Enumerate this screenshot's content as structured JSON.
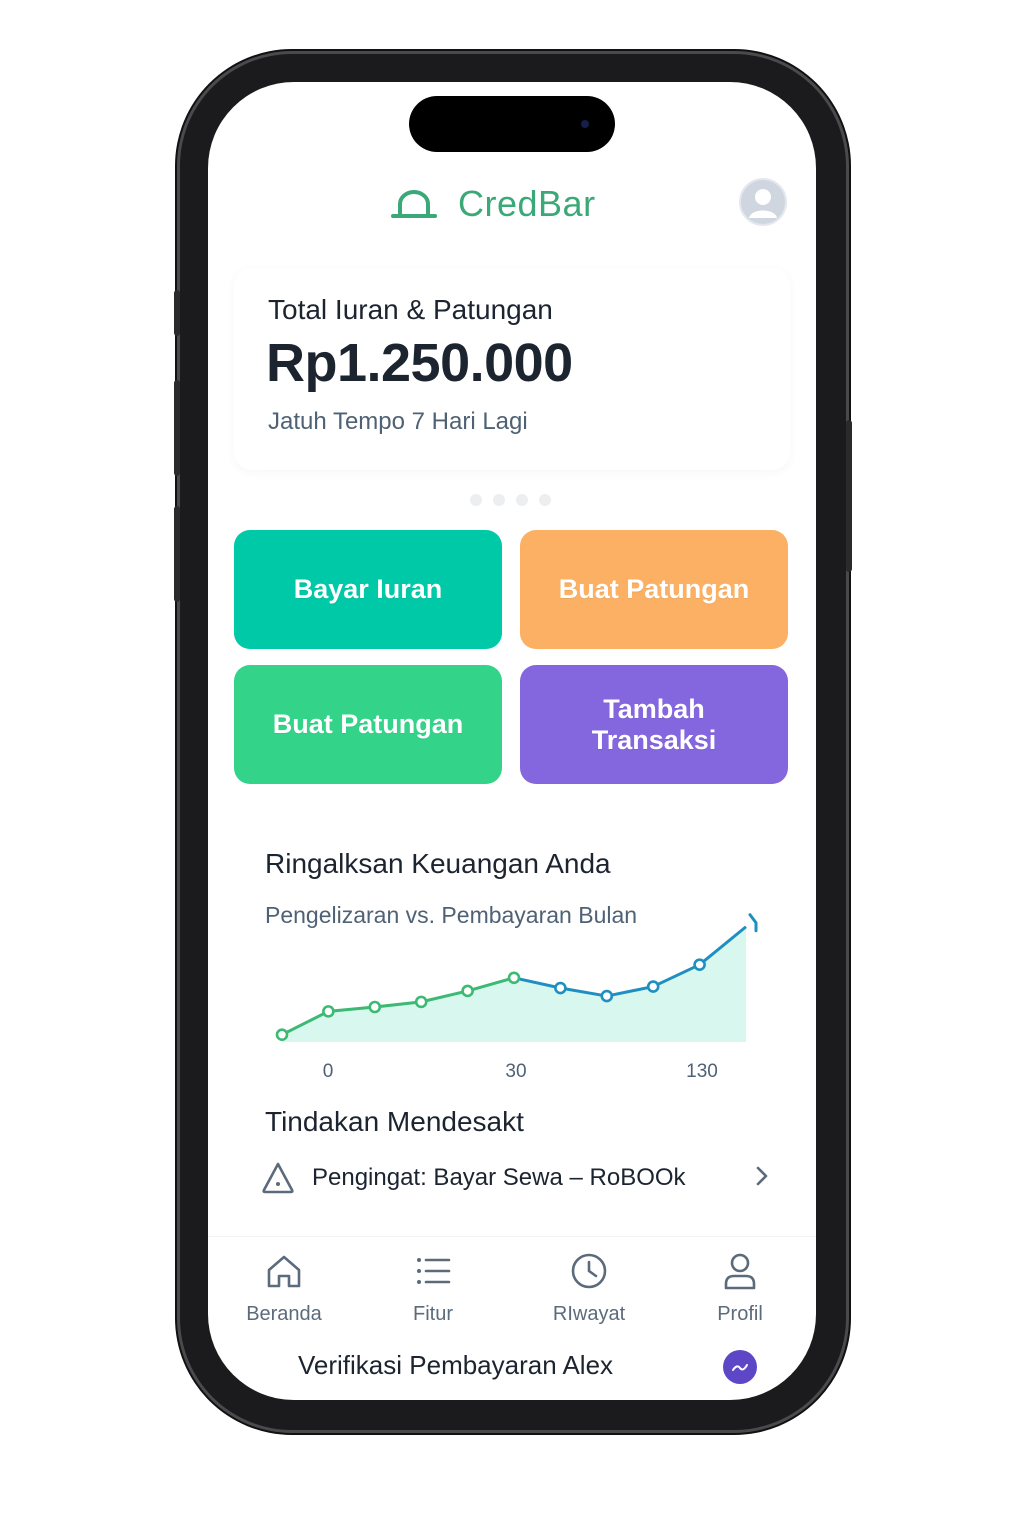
{
  "app": {
    "brand_name": "CredBar",
    "brand_color": "#3ba877"
  },
  "summary": {
    "title": "Total Iuran & Patungan",
    "amount": "Rp1.250.000",
    "due_text": "Jatuh Tempo 7 Hari Lagi",
    "carousel_pages": 4
  },
  "actions": [
    {
      "label": "Bayar Iuran",
      "color": "#00c9a7"
    },
    {
      "label": "Buat Patungan",
      "color": "#fbb063"
    },
    {
      "label": "Buat Patungan",
      "color": "#33d48a"
    },
    {
      "label": "Tambah\nTransaksi",
      "color": "#8466de"
    }
  ],
  "finance": {
    "title": "Ringalksan Keuangan Anda",
    "subtitle": "Pengelizaran vs. Pembayaran Bulan"
  },
  "chart_data": {
    "type": "line",
    "x_tick_labels": [
      "0",
      "30",
      "130"
    ],
    "values": [
      1.0,
      4.2,
      4.8,
      5.5,
      7.0,
      8.8,
      7.4,
      6.3,
      7.6,
      10.6,
      15.8
    ],
    "ylim": [
      0,
      17
    ],
    "fill": true,
    "segment_colors": [
      "#3cba73",
      "#1f8fc1"
    ],
    "trend_arrow": true
  },
  "urgent": {
    "title": "Tindakan Mendesakt",
    "reminder_text": "Pengingat: Bayar Sewa – RoBOOk",
    "reminder_icon": "warning-icon"
  },
  "nav": [
    {
      "label": "Beranda",
      "icon": "home-icon"
    },
    {
      "label": "Fitur",
      "icon": "list-icon"
    },
    {
      "label": "RIwayat",
      "icon": "clock-icon"
    },
    {
      "label": "Profil",
      "icon": "person-icon"
    }
  ],
  "toast": {
    "text": "Verifikasi Pembayaran Alex"
  }
}
